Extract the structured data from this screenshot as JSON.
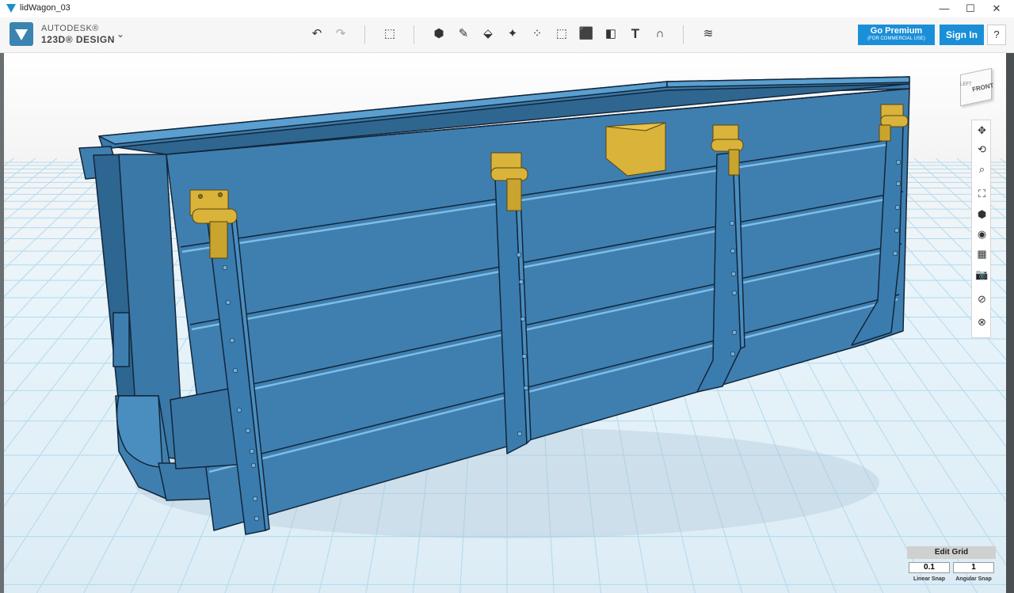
{
  "window": {
    "title": "lidWagon_03",
    "minimize_glyph": "—",
    "maximize_glyph": "☐",
    "close_glyph": "✕"
  },
  "brand": {
    "line1": "AUTODESK®",
    "line2": "123D® DESIGN",
    "menu_caret": "⌄"
  },
  "toolbar": {
    "tools": [
      {
        "name": "undo-icon",
        "glyph": "↶"
      },
      {
        "name": "redo-icon",
        "glyph": "↷"
      },
      {
        "name": "transform-icon",
        "glyph": "⬚"
      },
      {
        "name": "primitives-icon",
        "glyph": "⬢"
      },
      {
        "name": "sketch-icon",
        "glyph": "✎"
      },
      {
        "name": "construct-icon",
        "glyph": "⬙"
      },
      {
        "name": "modify-icon",
        "glyph": "✦"
      },
      {
        "name": "pattern-icon",
        "glyph": "⁘"
      },
      {
        "name": "grouping-icon",
        "glyph": "⬚"
      },
      {
        "name": "combine-icon",
        "glyph": "⬛"
      },
      {
        "name": "measure-icon",
        "glyph": "◧"
      },
      {
        "name": "text-icon",
        "glyph": "T"
      },
      {
        "name": "snap-icon",
        "glyph": "∩"
      },
      {
        "name": "material-icon",
        "glyph": "≋"
      }
    ],
    "premium_label": "Go Premium",
    "premium_sub": "(FOR COMMERCIAL USE)",
    "signin_label": "Sign In",
    "help_label": "?"
  },
  "viewcube": {
    "front_label": "FRONT",
    "left_label": "LEFT"
  },
  "nav": {
    "tools": [
      {
        "name": "pan-icon",
        "glyph": "✥"
      },
      {
        "name": "orbit-icon",
        "glyph": "⟲"
      },
      {
        "name": "zoom-icon",
        "glyph": "⌕"
      },
      {
        "name": "fit-icon",
        "glyph": "⛶"
      },
      {
        "name": "view-icon",
        "glyph": "⬢"
      },
      {
        "name": "visibility-icon",
        "glyph": "◉"
      },
      {
        "name": "material-view-icon",
        "glyph": "▦"
      },
      {
        "name": "screenshot-icon",
        "glyph": "📷"
      },
      {
        "name": "hide-sketch-icon",
        "glyph": "⊘"
      },
      {
        "name": "hide-mesh-icon",
        "glyph": "⊗"
      }
    ]
  },
  "grid": {
    "header": "Edit Grid",
    "linear_value": "0.1",
    "angular_value": "1",
    "linear_label": "Linear Snap",
    "angular_label": "Angular Snap"
  },
  "colors": {
    "model_blue": "#3f7fb0",
    "model_dark": "#1e3f5c",
    "model_light": "#5a9fd0",
    "brass": "#d9b33a",
    "accent": "#1a8fd8"
  }
}
